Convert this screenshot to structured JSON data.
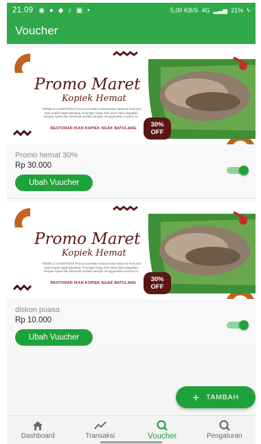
{
  "status_bar": {
    "time": "21.09",
    "notifications": "◉ ● ◆ ♪ ▣ •",
    "speed": "5,00 KB/S",
    "network": "4G",
    "battery": "21%"
  },
  "app_bar": {
    "title": "Voucher"
  },
  "banner": {
    "title": "Promo Maret",
    "subtitle": "Kopiek Hemat",
    "small_text": "TERMS & CONDITIONS Promo ini berlaku selama bulan Maret di Restoran Ikan Kopiek Ngak Batulang. Potongan harga 30% akan kamu dapatkan dengan syarat dan ketentuan berlaku dengan menggunakan voucher ini.",
    "store": "RESTORAN IKAN KOPIEK NGAK BATULANG",
    "badge_percent": "30%",
    "badge_off": "OFF"
  },
  "vouchers": [
    {
      "name": "Promo hemat 30%",
      "price": "Rp 30.000",
      "button": "Ubah Vuucher",
      "active": true
    },
    {
      "name": "diskon puasa",
      "price": "Rp 10.000",
      "button": "Ubah Vuucher",
      "active": true
    }
  ],
  "fab": {
    "icon": "plus-icon",
    "label": "TAMBAH"
  },
  "bottom_nav": [
    {
      "label": "Dashboard",
      "icon": "home-icon"
    },
    {
      "label": "Transaksi",
      "icon": "trend-icon"
    },
    {
      "label": "Voucher",
      "icon": "voucher-search-icon",
      "active": true
    },
    {
      "label": "Pengaturan",
      "icon": "settings-search-icon"
    }
  ],
  "colors": {
    "primary": "#2fa94a",
    "button": "#1fa23a",
    "banner_text": "#5a1515"
  }
}
